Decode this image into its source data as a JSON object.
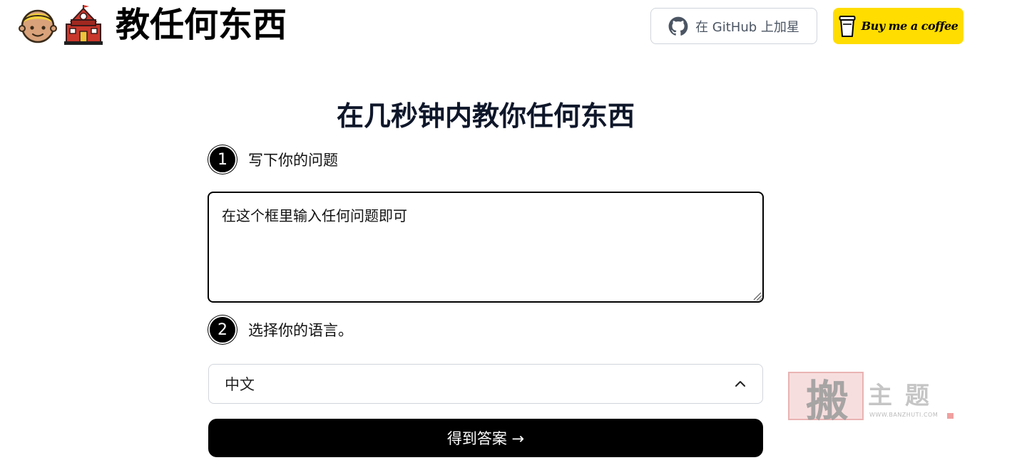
{
  "header": {
    "brand_title": "教任何东西",
    "emoji_face": "person-blond-hair-icon",
    "emoji_school": "school-building-icon",
    "github_label": "在 GitHub 上加星",
    "coffee_label": "Buy me a coffee"
  },
  "main": {
    "title": "在几秒钟内教你任何东西",
    "step1": {
      "number": "1",
      "label": "写下你的问题"
    },
    "question_value": "在这个框里输入任何问题即可",
    "step2": {
      "number": "2",
      "label": "选择你的语言。"
    },
    "language_selected": "中文",
    "submit_label": "得到答案 →"
  },
  "watermark": {
    "stamp_char": "搬",
    "text": "主题",
    "url": "WWW.BANZHUTI.COM"
  },
  "colors": {
    "accent_yellow": "#ffdd00",
    "primary_black": "#000000",
    "border_gray": "#d1d5db",
    "title_dark": "#0f172a"
  }
}
